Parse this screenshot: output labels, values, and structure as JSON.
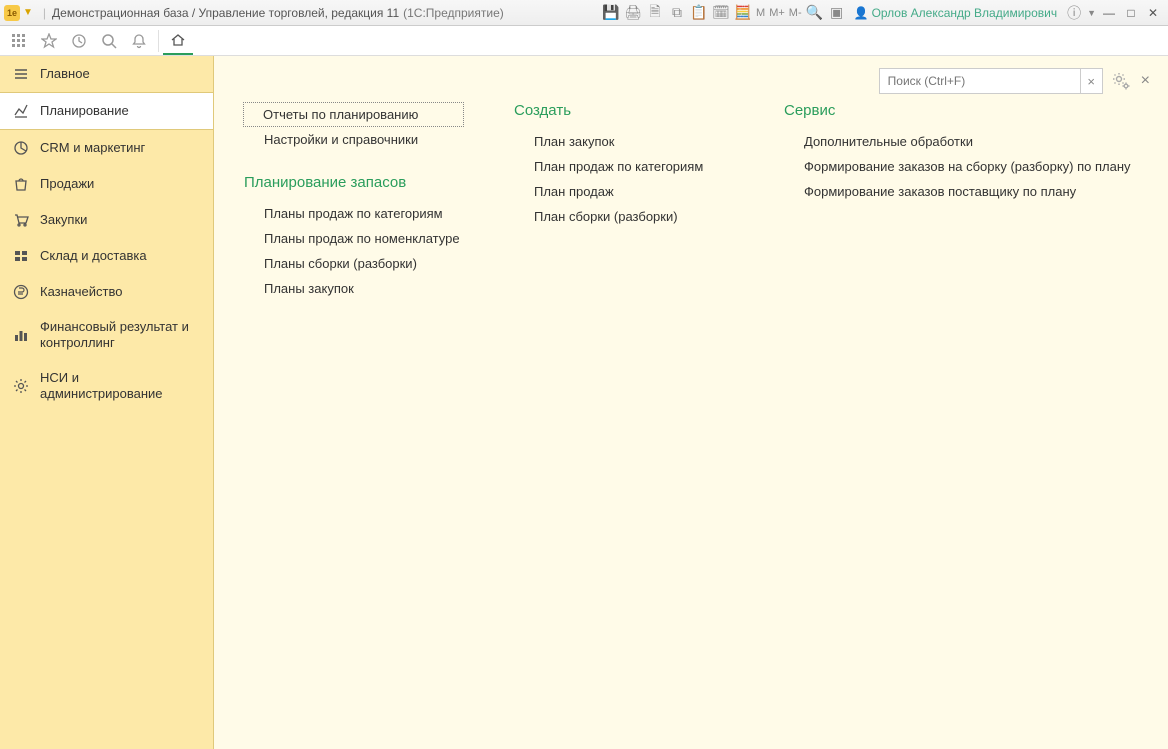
{
  "titlebar": {
    "app_prefix": "Демонстрационная база / Управление торговлей, редакция 11",
    "app_suffix": "(1С:Предприятие)",
    "user": "Орлов Александр Владимирович"
  },
  "toolbar_icons": {
    "apps": "apps",
    "star": "star",
    "history": "history",
    "search": "search",
    "bell": "bell",
    "home": "home"
  },
  "sidebar": {
    "items": [
      {
        "icon": "menu",
        "label": "Главное"
      },
      {
        "icon": "planning",
        "label": "Планирование"
      },
      {
        "icon": "pie",
        "label": "CRM и маркетинг"
      },
      {
        "icon": "bag",
        "label": "Продажи"
      },
      {
        "icon": "cart",
        "label": "Закупки"
      },
      {
        "icon": "warehouse",
        "label": "Склад и доставка"
      },
      {
        "icon": "ruble",
        "label": "Казначейство"
      },
      {
        "icon": "bars",
        "label": "Финансовый результат и контроллинг"
      },
      {
        "icon": "gear",
        "label": "НСИ и администрирование"
      }
    ],
    "active_index": 1
  },
  "search": {
    "placeholder": "Поиск (Ctrl+F)"
  },
  "columns": [
    {
      "title": "",
      "links": [
        {
          "label": "Отчеты по планированию",
          "focused": true
        },
        {
          "label": "Настройки и справочники"
        }
      ],
      "subsections": [
        {
          "title": "Планирование запасов",
          "links": [
            {
              "label": "Планы продаж по категориям"
            },
            {
              "label": "Планы продаж по номенклатуре"
            },
            {
              "label": "Планы сборки (разборки)"
            },
            {
              "label": "Планы закупок"
            }
          ]
        }
      ]
    },
    {
      "title": "Создать",
      "links": [
        {
          "label": "План закупок"
        },
        {
          "label": "План продаж по категориям"
        },
        {
          "label": "План продаж"
        },
        {
          "label": "План сборки (разборки)"
        }
      ]
    },
    {
      "title": "Сервис",
      "links": [
        {
          "label": "Дополнительные обработки"
        },
        {
          "label": "Формирование заказов на сборку (разборку) по плану"
        },
        {
          "label": "Формирование заказов поставщику по плану"
        }
      ]
    }
  ],
  "titlebar_buttons": {
    "m": "M",
    "mplus": "M+",
    "mminus": "M-"
  }
}
